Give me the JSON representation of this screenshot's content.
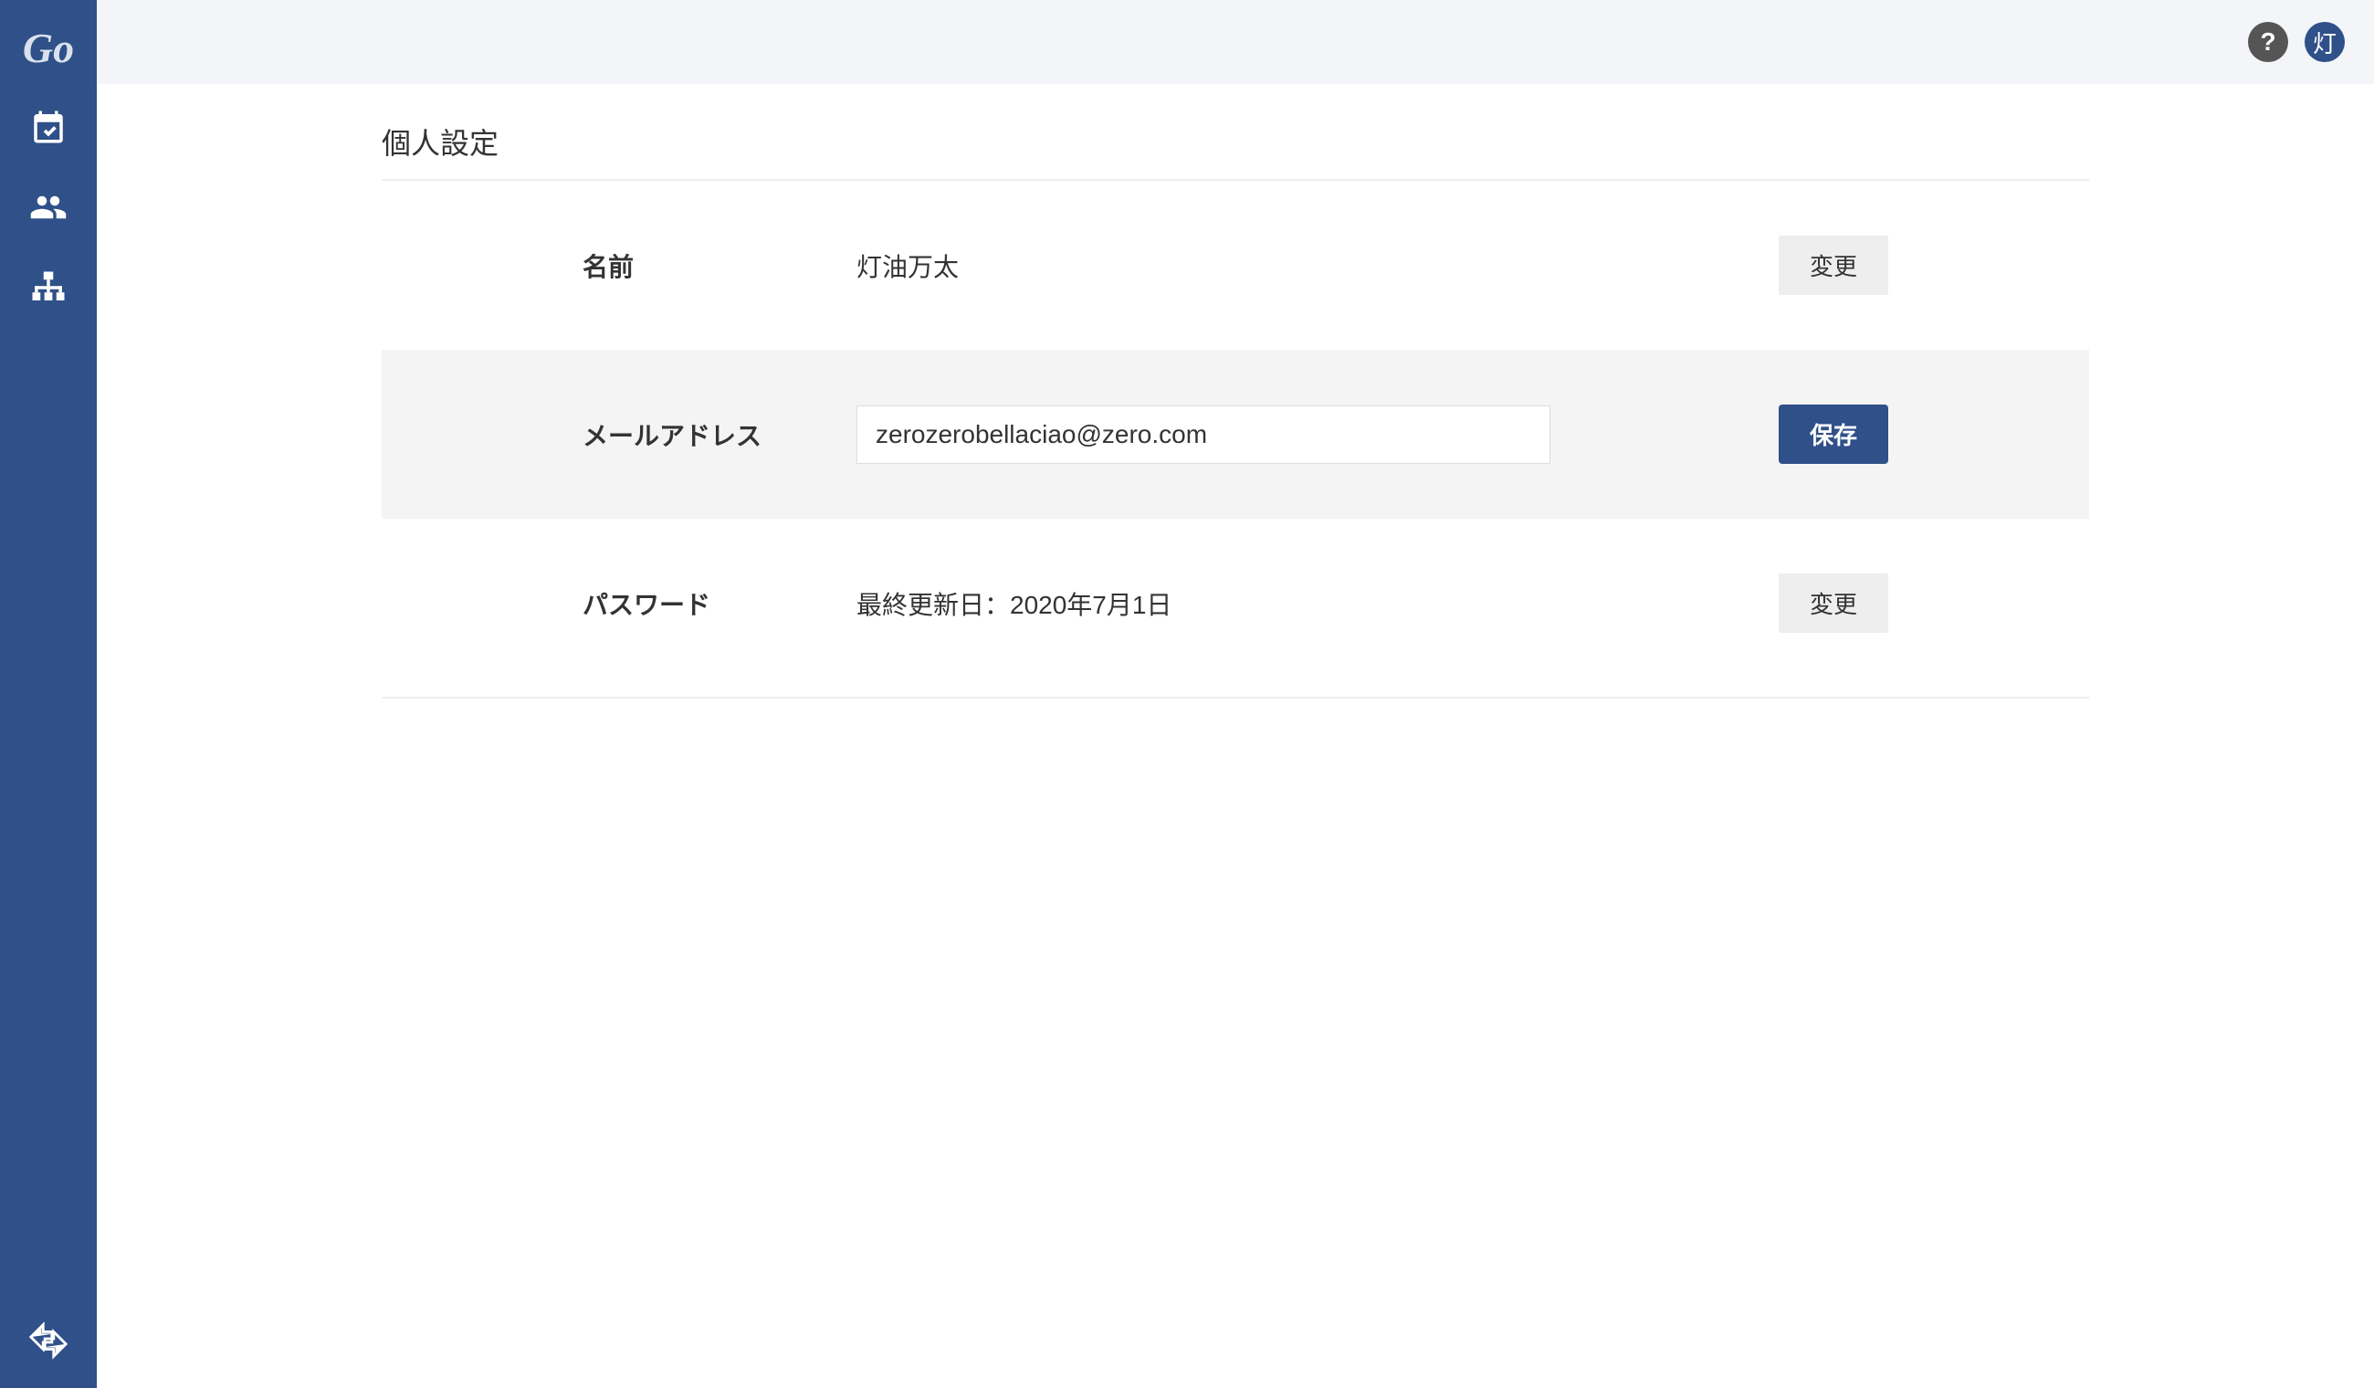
{
  "sidebar": {
    "logo": "Go"
  },
  "topbar": {
    "help_symbol": "?",
    "avatar_char": "灯"
  },
  "page": {
    "title": "個人設定"
  },
  "settings": {
    "name": {
      "label": "名前",
      "value": "灯油万太",
      "action": "変更"
    },
    "email": {
      "label": "メールアドレス",
      "value": "zerozerobellaciao@zero.com",
      "action": "保存"
    },
    "password": {
      "label": "パスワード",
      "value": "最終更新日：2020年7月1日",
      "action": "変更"
    }
  }
}
